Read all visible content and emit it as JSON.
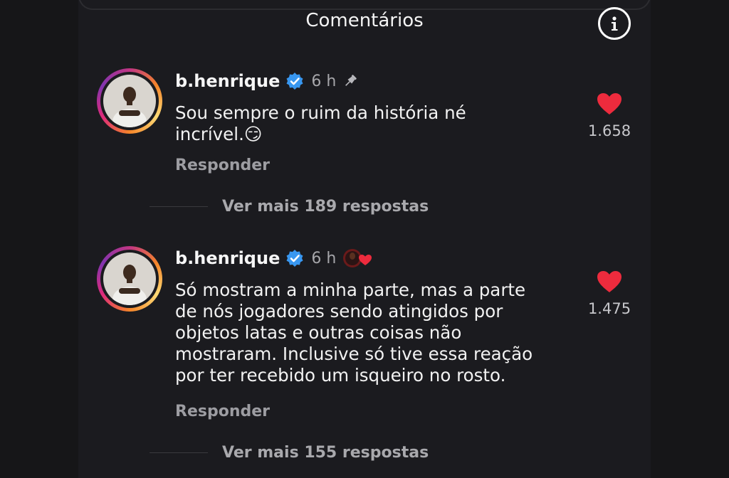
{
  "header": {
    "title": "Comentários",
    "info_icon": "info-icon"
  },
  "comments": [
    {
      "username": "b.henrique",
      "time": "6 h",
      "marker_icon": "pin-icon",
      "text_lines": [
        "Sou sempre o ruim da história né",
        "incrível.😏"
      ],
      "likes": "1.658",
      "reply_label": "Responder",
      "more_replies": "Ver mais 189 respostas"
    },
    {
      "username": "b.henrique",
      "time": "6 h",
      "marker_icon": "profile-badge-heart-icon",
      "text_lines": [
        "Só mostram a minha parte, mas a parte",
        "de nós jogadores sendo atingidos por",
        "objetos latas e outras coisas não",
        "mostraram. Inclusive só tive essa reação",
        "por ter recebido um isqueiro no rosto."
      ],
      "likes": "1.475",
      "reply_label": "Responder",
      "more_replies": "Ver mais 155 respostas"
    }
  ],
  "colors": {
    "background": "#1b1b1f",
    "heart": "#ed2b3d",
    "verified": "#3897f0"
  }
}
